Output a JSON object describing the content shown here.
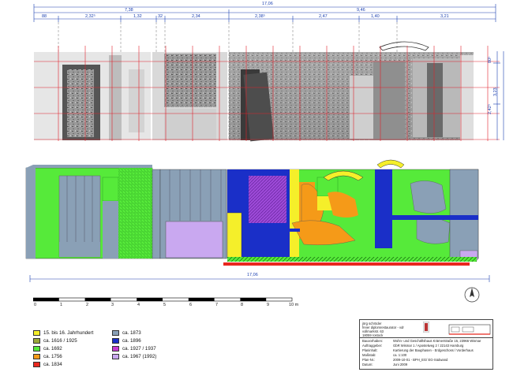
{
  "dimensions": {
    "top_total": "17,06",
    "top_left_span": "7,38",
    "top_right_span": "9,46",
    "segments": [
      "88",
      "2,32⁵",
      "1,32",
      "32",
      "2,34",
      "2,38⁵",
      "2,47",
      "1,40",
      "3,21"
    ],
    "right_heights": [
      "80⁵",
      "3,23",
      "2,42⁵"
    ],
    "middle_total": "17,06"
  },
  "scale_bar": {
    "labels": [
      "0",
      "1",
      "2",
      "3",
      "4",
      "5",
      "6",
      "7",
      "8",
      "9",
      "10 m"
    ]
  },
  "legend": {
    "left": [
      {
        "label": "15. bis 16. Jahrhundert",
        "color": "#f5ef2a"
      },
      {
        "label": "ca. 1616 / 1925",
        "color": "#9aa83a"
      },
      {
        "label": "ca. 1692",
        "color": "#56ea3a"
      },
      {
        "label": "ca. 1756",
        "color": "#f59a18"
      },
      {
        "label": "ca. 1834",
        "color": "#e8281e"
      }
    ],
    "right": [
      {
        "label": "ca. 1873",
        "color": "#8aa0b6"
      },
      {
        "label": "ca. 1896",
        "color": "#1a2fc8"
      },
      {
        "label": "ca. 1927 / 1937",
        "color": "#c83ad0"
      },
      {
        "label": "ca. 1967 (1992)",
        "color": "#c9a8f0"
      }
    ]
  },
  "title_block": {
    "author_lines": [
      "jörg schröder",
      "freier diplomrestaurator - vdr",
      "vollmarkstr. 63",
      "18059 rostock"
    ],
    "fields": [
      {
        "key": "Bauvorhaben:",
        "value": "Wohn- und Geschäftshaus Krämerstraße 15, 23966 Wismar"
      },
      {
        "key": "Auftraggeber:",
        "value": "GbR Wismar 1 / Apostelweg 2 / 22143 Hamburg"
      },
      {
        "key": "Planinhalt:",
        "value": "Kartierung der Bauphasen - Erdgeschoss / Vorderhaus"
      },
      {
        "key": "Maßstab:",
        "value": "ca. 1:100"
      },
      {
        "key": "Plan-Nr.:",
        "value": "2009-10-01 - BPH_EG/ EG-Südwand"
      },
      {
        "key": "Datum:",
        "value": "Juni 2009"
      }
    ]
  },
  "colors": {
    "dimension_line": "#1a3fb0",
    "grid_red": "#e0202a",
    "baseline_red": "#e8281e"
  }
}
